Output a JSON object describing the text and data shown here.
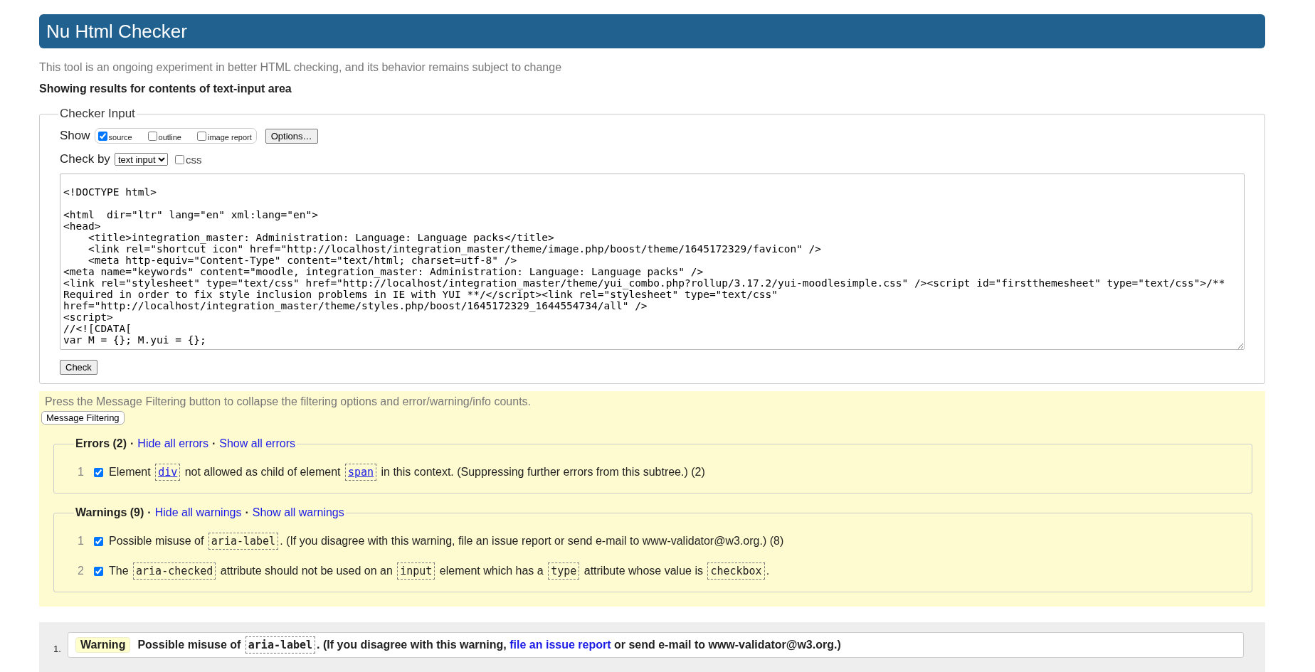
{
  "header": {
    "title": "Nu Html Checker"
  },
  "intro": "This tool is an ongoing experiment in better HTML checking, and its behavior remains subject to change",
  "results_heading": "Showing results for contents of text-input area",
  "checker_input": {
    "legend": "Checker Input",
    "show_label": "Show",
    "show_options": [
      {
        "label": "source",
        "checked": true
      },
      {
        "label": "outline",
        "checked": false
      },
      {
        "label": "image report",
        "checked": false
      }
    ],
    "options_button": "Options…",
    "check_by_label": "Check by",
    "check_by_select": "text input",
    "css_option": {
      "label": "css",
      "checked": false
    },
    "source_lines": [
      {
        "blank_before": true,
        "text": "<!DOCTYPE html>"
      },
      {
        "blank_before": true,
        "text": "<html  dir=\"ltr\" lang=\"en\" xml:lang=\"en\">"
      },
      "<head>",
      "    <title>integration_master: Administration: Language: Language packs</title>",
      "    <link rel=\"shortcut icon\" href=\"http://localhost/integration_master/theme/image.php/boost/theme/1645172329/favicon\" />",
      "    <meta http-equiv=\"Content-Type\" content=\"text/html; charset=utf-8\" />",
      "<meta name=\"keywords\" content=\"moodle, integration_master: Administration: Language: Language packs\" />",
      "<link rel=\"stylesheet\" type=\"text/css\" href=\"http://localhost/integration_master/theme/yui_combo.php?rollup/3.17.2/yui-moodlesimple.css\" /><script id=\"firstthemesheet\" type=\"text/css\">/**",
      "Required in order to fix style inclusion problems in IE with YUI **/</script><link rel=\"stylesheet\" type=\"text/css\"",
      "href=\"http://localhost/integration_master/theme/styles.php/boost/1645172329_1644554734/all\" />",
      "<script>",
      "//<![CDATA[",
      "var M = {}; M.yui = {};"
    ],
    "check_button": "Check"
  },
  "filtering": {
    "hint": "Press the Message Filtering button to collapse the filtering options and error/warning/info counts.",
    "button": "Message Filtering",
    "groups": [
      {
        "title": "Errors (2)",
        "separator": "·",
        "links": [
          "Hide all errors",
          "Show all errors"
        ],
        "messages": [
          {
            "number": "1",
            "checked": true,
            "parts": [
              {
                "kind": "text",
                "text": "Element "
              },
              {
                "kind": "code-link",
                "text": "div"
              },
              {
                "kind": "text",
                "text": " not allowed as child of element "
              },
              {
                "kind": "code-link",
                "text": "span"
              },
              {
                "kind": "text",
                "text": " in this context. (Suppressing further errors from this subtree.) (2)"
              }
            ]
          }
        ]
      },
      {
        "title": "Warnings (9)",
        "separator": "·",
        "links": [
          "Hide all warnings",
          "Show all warnings"
        ],
        "messages": [
          {
            "number": "1",
            "checked": true,
            "parts": [
              {
                "kind": "text",
                "text": "Possible misuse of "
              },
              {
                "kind": "code",
                "text": "aria-label"
              },
              {
                "kind": "text",
                "text": ". (If you disagree with this warning, file an issue report or send e-mail to www-validator@w3.org.) (8)"
              }
            ]
          },
          {
            "number": "2",
            "checked": true,
            "parts": [
              {
                "kind": "text",
                "text": "The "
              },
              {
                "kind": "code",
                "text": "aria-checked"
              },
              {
                "kind": "text",
                "text": " attribute should not be used on an "
              },
              {
                "kind": "code",
                "text": "input"
              },
              {
                "kind": "text",
                "text": " element which has a "
              },
              {
                "kind": "code",
                "text": "type"
              },
              {
                "kind": "text",
                "text": " attribute whose value is "
              },
              {
                "kind": "code",
                "text": "checkbox"
              },
              {
                "kind": "text",
                "text": "."
              }
            ]
          }
        ]
      }
    ]
  },
  "results": [
    {
      "number": "1.",
      "type": "Warning",
      "parts": [
        {
          "kind": "text",
          "text": "Possible misuse of "
        },
        {
          "kind": "code",
          "text": "aria-label"
        },
        {
          "kind": "text",
          "text": ". (If you disagree with this warning, "
        },
        {
          "kind": "link",
          "text": "file an issue report"
        },
        {
          "kind": "text",
          "text": " or send e-mail to www-validator@w3.org.)"
        }
      ]
    }
  ]
}
